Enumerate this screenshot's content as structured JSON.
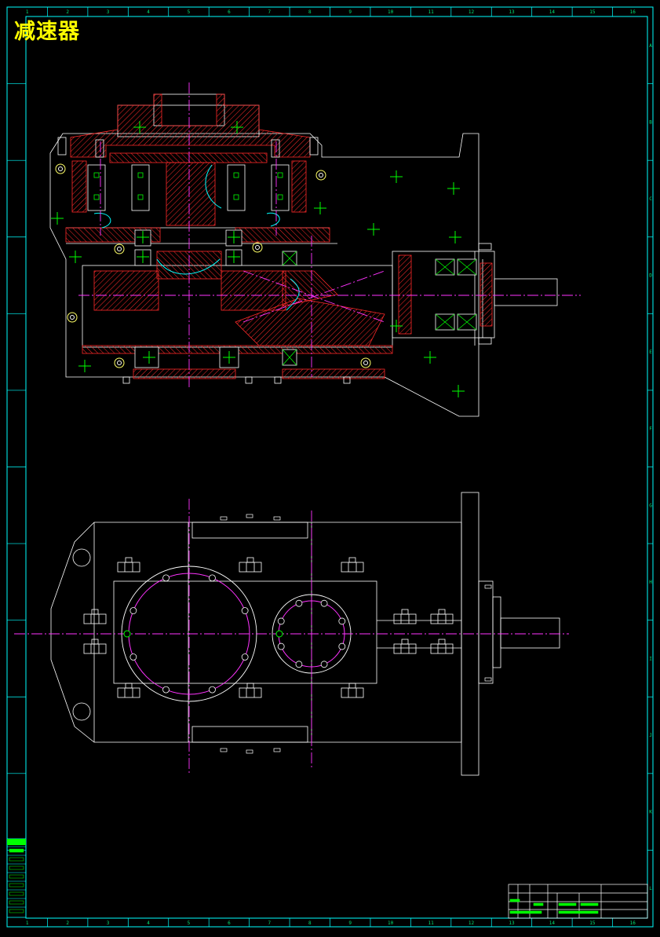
{
  "drawing": {
    "title": "减速器",
    "colors": {
      "background": "#000000",
      "frame": "#00ffff",
      "outline": "#ffffff",
      "hatch": "#ff2a2a",
      "centerline": "#ff33ff",
      "center_mark": "#00ff00",
      "weld": "#00ffff",
      "title_text": "#ffff00",
      "zone_text": "#00e676"
    },
    "zones": {
      "columns": [
        "1",
        "2",
        "3",
        "4",
        "5",
        "6",
        "7",
        "8",
        "9",
        "10",
        "11",
        "12",
        "13",
        "14",
        "15",
        "16"
      ],
      "rows": [
        "A",
        "B",
        "C",
        "D",
        "E",
        "F",
        "G",
        "H",
        "I",
        "J",
        "K",
        "L"
      ]
    },
    "views": [
      {
        "name": "sectional-front-view",
        "icon": "gear-section-icon"
      },
      {
        "name": "top-plan-view",
        "icon": "housing-plan-icon"
      }
    ]
  }
}
